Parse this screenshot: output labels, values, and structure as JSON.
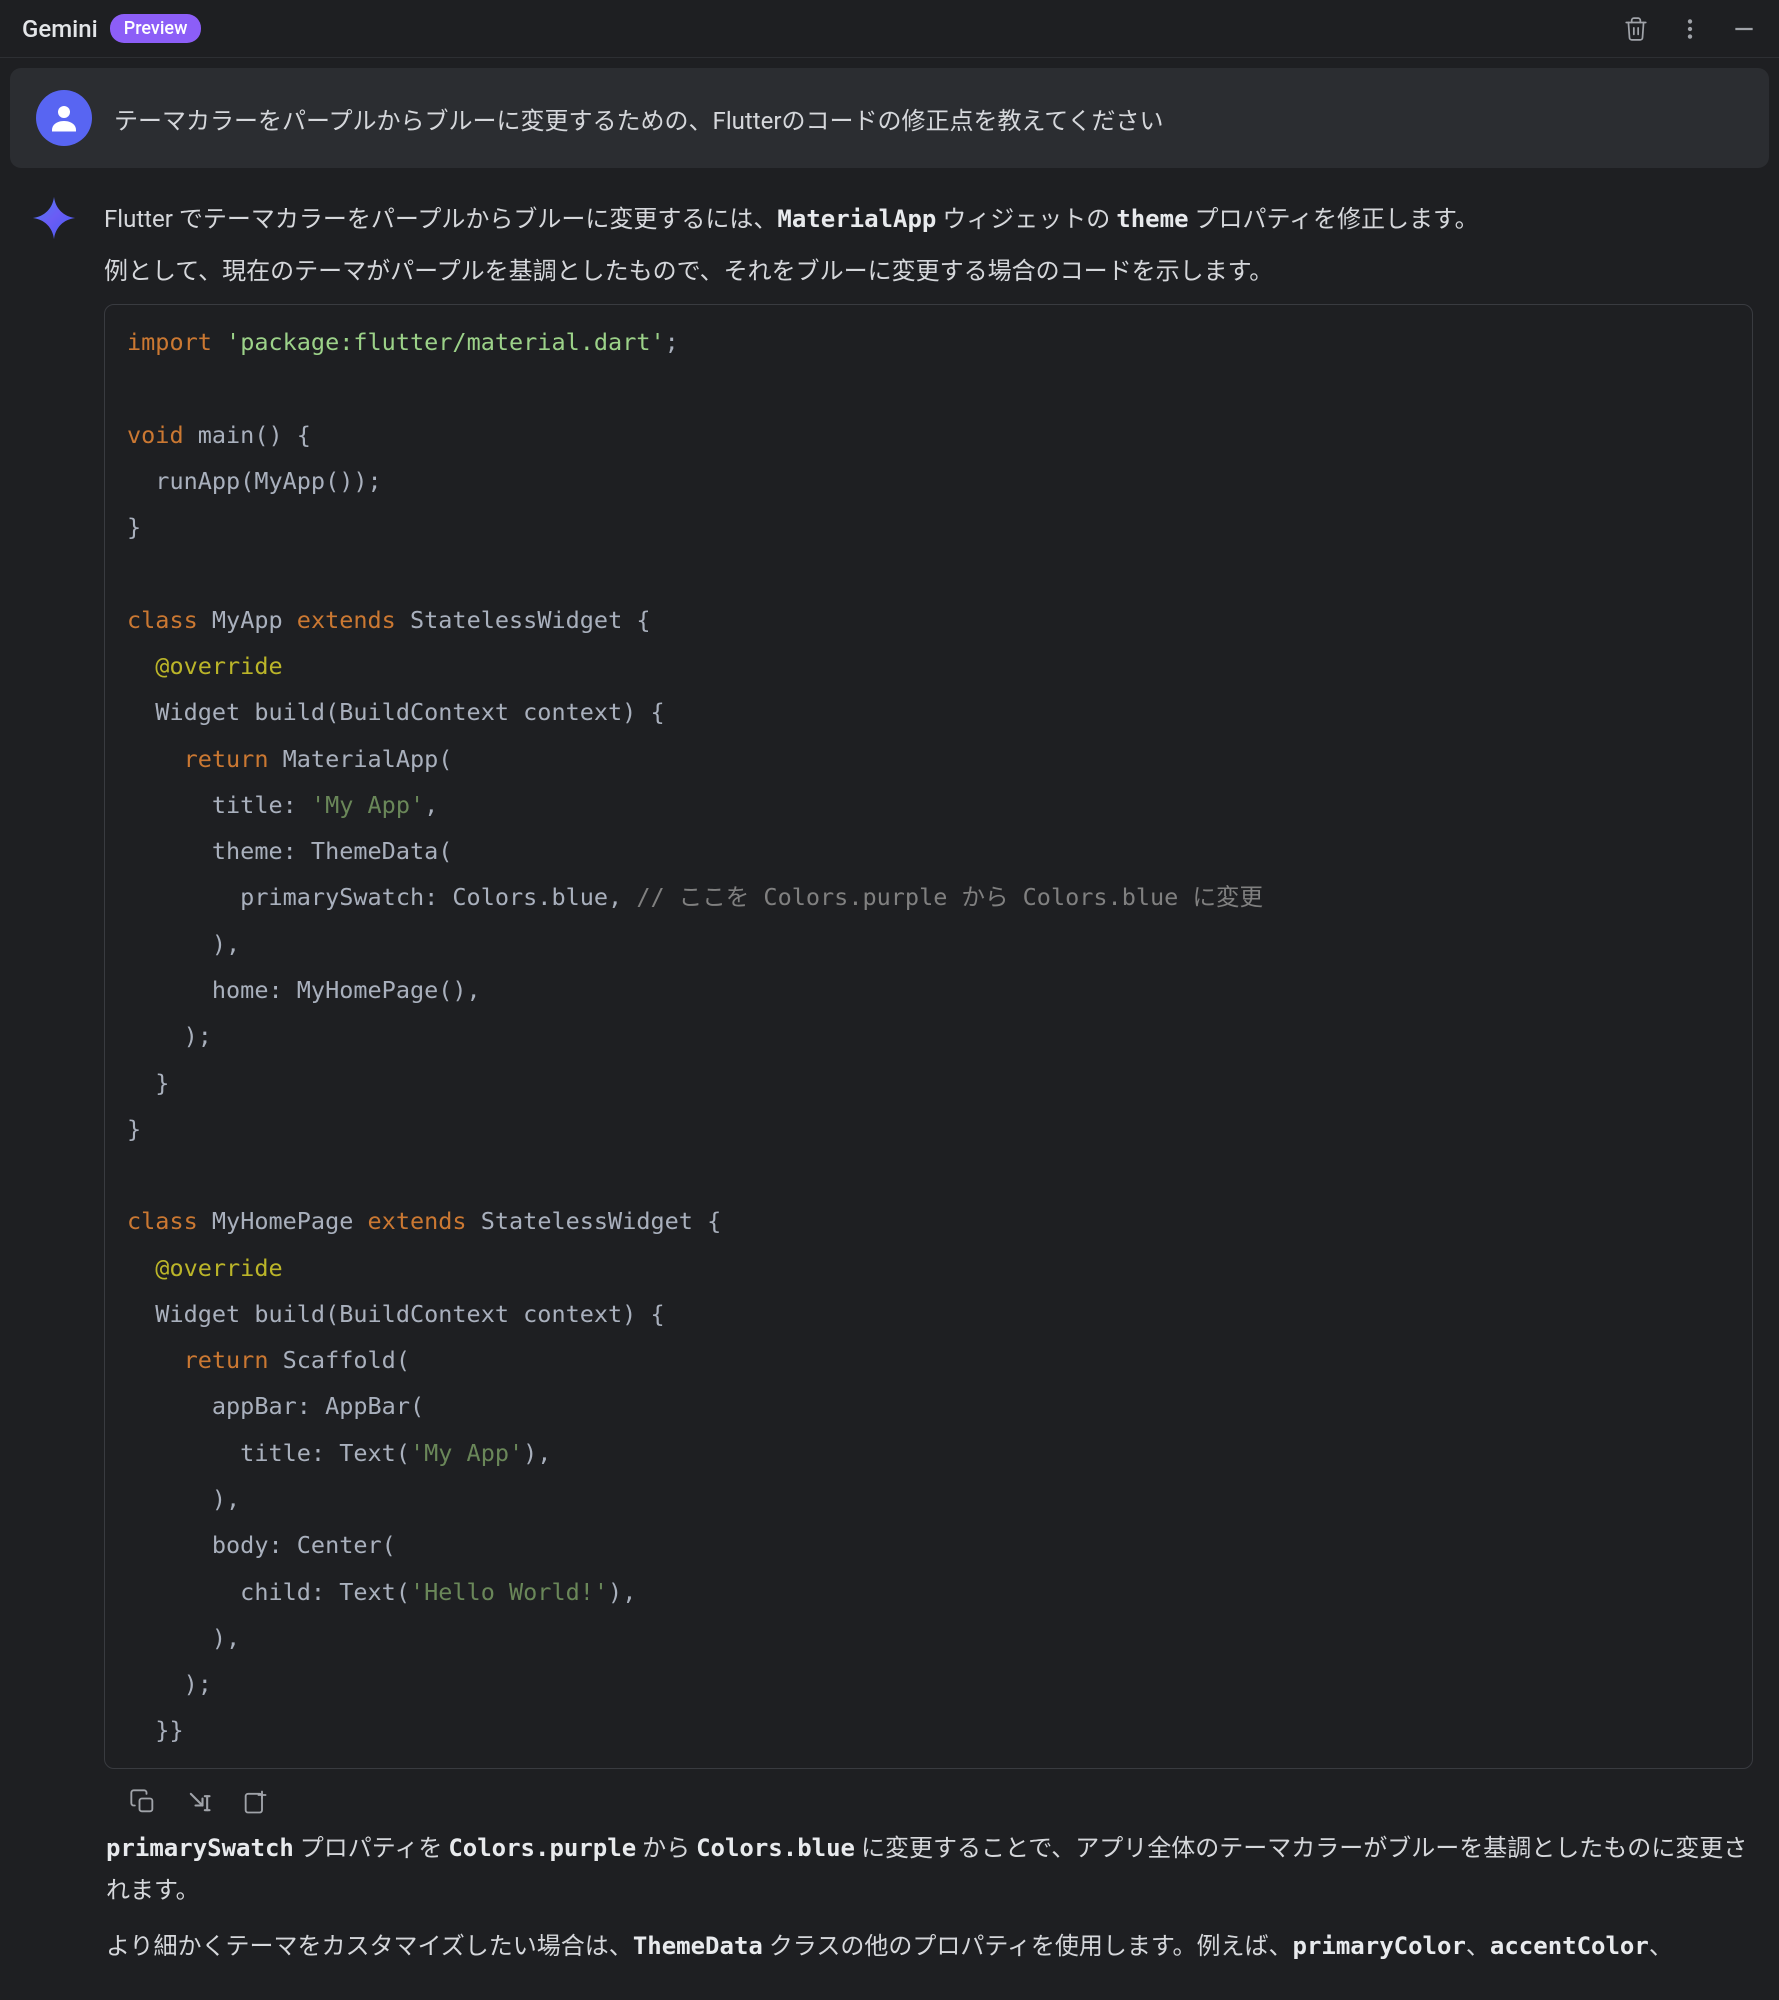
{
  "header": {
    "title": "Gemini",
    "badge": "Preview"
  },
  "user_message": {
    "text": "テーマカラーをパープルからブルーに変更するための、Flutterのコードの修正点を教えてください"
  },
  "ai_message": {
    "intro_line1_a": "Flutter でテーマカラーをパープルからブルーに変更するには、",
    "intro_line1_b": "MaterialApp",
    "intro_line1_c": " ウィジェットの ",
    "intro_line1_d": "theme",
    "intro_line1_e": " プロパティを修正します。",
    "intro_line2": "例として、現在のテーマがパープルを基調としたもので、それをブルーに変更する場合のコードを示します。",
    "code": {
      "l01_a": "import",
      "l01_b": "'package:flutter/material.dart'",
      "l01_c": ";",
      "l02_a": "void",
      "l02_b": " main() {",
      "l03": "  runApp(MyApp());",
      "l04": "}",
      "l05_a": "class",
      "l05_b": " MyApp ",
      "l05_c": "extends",
      "l05_d": " StatelessWidget {",
      "l06": "  @override",
      "l07": "  Widget build(BuildContext context) {",
      "l08_a": "    ",
      "l08_b": "return",
      "l08_c": " MaterialApp(",
      "l09_a": "      title: ",
      "l09_b": "'My App'",
      "l09_c": ",",
      "l10": "      theme: ThemeData(",
      "l11_a": "        primarySwatch: Colors.blue, ",
      "l11_b": "// ここを Colors.purple から Colors.blue に変更",
      "l12": "      ),",
      "l13": "      home: MyHomePage(),",
      "l14": "    );",
      "l15": "  }",
      "l16": "}",
      "l17_a": "class",
      "l17_b": " MyHomePage ",
      "l17_c": "extends",
      "l17_d": " StatelessWidget {",
      "l18": "  @override",
      "l19": "  Widget build(BuildContext context) {",
      "l20_a": "    ",
      "l20_b": "return",
      "l20_c": " Scaffold(",
      "l21": "      appBar: AppBar(",
      "l22_a": "        title: Text(",
      "l22_b": "'My App'",
      "l22_c": "),",
      "l23": "      ),",
      "l24": "      body: Center(",
      "l25_a": "        child: Text(",
      "l25_b": "'Hello World!'",
      "l25_c": "),",
      "l26": "      ),",
      "l27": "    );",
      "l28": "  }}"
    },
    "follow1_a": "primarySwatch",
    "follow1_b": " プロパティを ",
    "follow1_c": "Colors.purple",
    "follow1_d": " から ",
    "follow1_e": "Colors.blue",
    "follow1_f": " に変更することで、アプリ全体のテーマカラーがブルーを基調としたものに変更されます。",
    "follow2_a": "より細かくテーマをカスタマイズしたい場合は、",
    "follow2_b": "ThemeData",
    "follow2_c": " クラスの他のプロパティを使用します。例えば、",
    "follow2_d": "primaryColor",
    "follow2_e": "、",
    "follow2_f": "accentColor",
    "follow2_g": "、"
  }
}
